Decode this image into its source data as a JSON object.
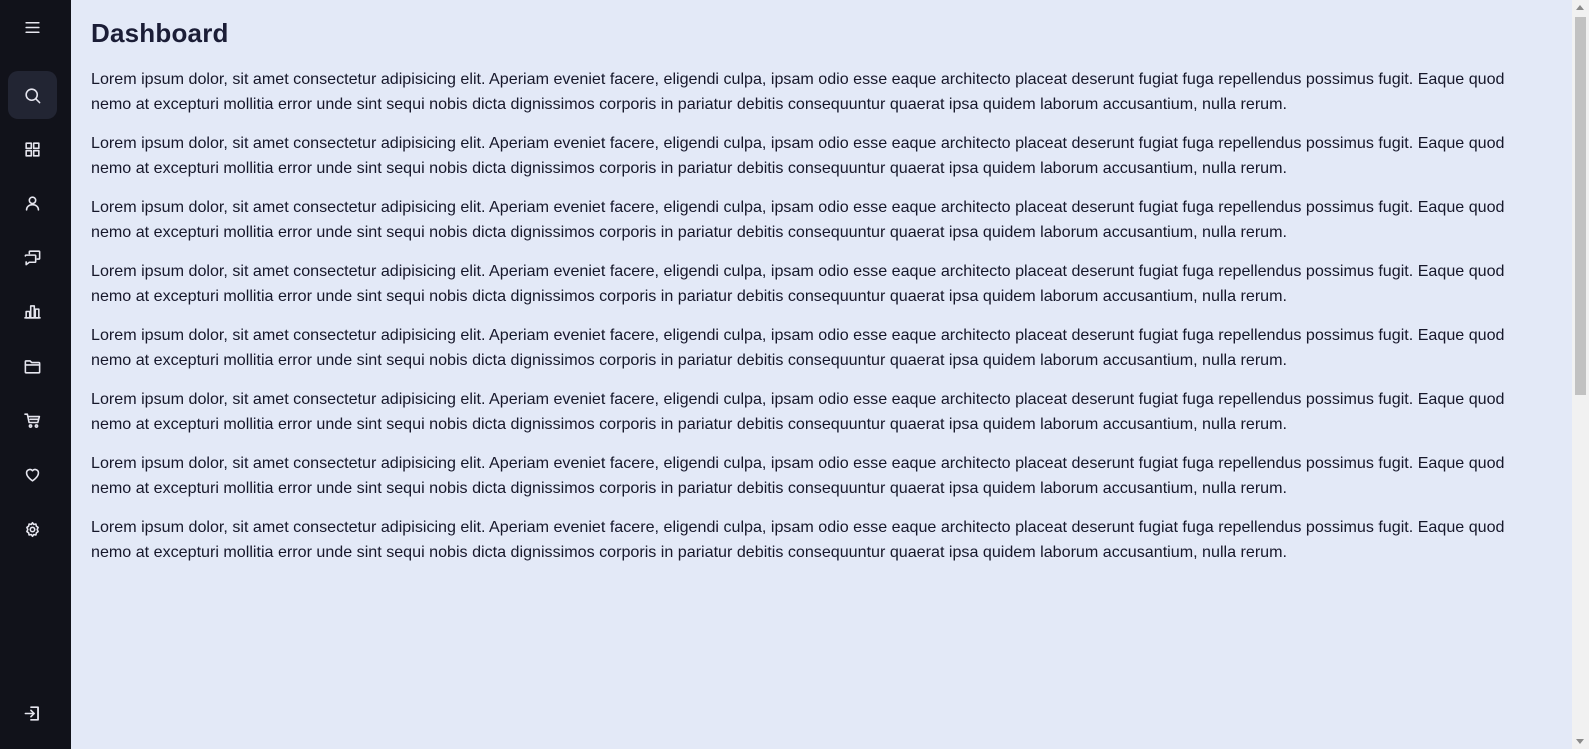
{
  "colors": {
    "sidebar_bg": "#11121a",
    "active_item_bg": "#222533",
    "main_bg": "#e3e9f7",
    "title_text": "#1b1d36",
    "body_text": "#16172a"
  },
  "sidebar": {
    "items": [
      {
        "icon": "menu-icon",
        "active": false
      },
      {
        "icon": "search-icon",
        "active": true
      },
      {
        "icon": "dashboard-grid-icon",
        "active": false
      },
      {
        "icon": "user-icon",
        "active": false
      },
      {
        "icon": "chat-icon",
        "active": false
      },
      {
        "icon": "bar-chart-icon",
        "active": false
      },
      {
        "icon": "folder-icon",
        "active": false
      },
      {
        "icon": "cart-icon",
        "active": false
      },
      {
        "icon": "heart-icon",
        "active": false
      },
      {
        "icon": "gear-icon",
        "active": false
      },
      {
        "icon": "logout-icon",
        "active": false
      }
    ]
  },
  "main": {
    "title": "Dashboard",
    "paragraphs": [
      "Lorem ipsum dolor, sit amet consectetur adipisicing elit. Aperiam eveniet facere, eligendi culpa, ipsam odio esse eaque architecto placeat deserunt fugiat fuga repellendus possimus fugit. Eaque quod nemo at excepturi mollitia error unde sint sequi nobis dicta dignissimos corporis in pariatur debitis consequuntur quaerat ipsa quidem laborum accusantium, nulla rerum.",
      "Lorem ipsum dolor, sit amet consectetur adipisicing elit. Aperiam eveniet facere, eligendi culpa, ipsam odio esse eaque architecto placeat deserunt fugiat fuga repellendus possimus fugit. Eaque quod nemo at excepturi mollitia error unde sint sequi nobis dicta dignissimos corporis in pariatur debitis consequuntur quaerat ipsa quidem laborum accusantium, nulla rerum.",
      "Lorem ipsum dolor, sit amet consectetur adipisicing elit. Aperiam eveniet facere, eligendi culpa, ipsam odio esse eaque architecto placeat deserunt fugiat fuga repellendus possimus fugit. Eaque quod nemo at excepturi mollitia error unde sint sequi nobis dicta dignissimos corporis in pariatur debitis consequuntur quaerat ipsa quidem laborum accusantium, nulla rerum.",
      "Lorem ipsum dolor, sit amet consectetur adipisicing elit. Aperiam eveniet facere, eligendi culpa, ipsam odio esse eaque architecto placeat deserunt fugiat fuga repellendus possimus fugit. Eaque quod nemo at excepturi mollitia error unde sint sequi nobis dicta dignissimos corporis in pariatur debitis consequuntur quaerat ipsa quidem laborum accusantium, nulla rerum.",
      "Lorem ipsum dolor, sit amet consectetur adipisicing elit. Aperiam eveniet facere, eligendi culpa, ipsam odio esse eaque architecto placeat deserunt fugiat fuga repellendus possimus fugit. Eaque quod nemo at excepturi mollitia error unde sint sequi nobis dicta dignissimos corporis in pariatur debitis consequuntur quaerat ipsa quidem laborum accusantium, nulla rerum.",
      "Lorem ipsum dolor, sit amet consectetur adipisicing elit. Aperiam eveniet facere, eligendi culpa, ipsam odio esse eaque architecto placeat deserunt fugiat fuga repellendus possimus fugit. Eaque quod nemo at excepturi mollitia error unde sint sequi nobis dicta dignissimos corporis in pariatur debitis consequuntur quaerat ipsa quidem laborum accusantium, nulla rerum.",
      "Lorem ipsum dolor, sit amet consectetur adipisicing elit. Aperiam eveniet facere, eligendi culpa, ipsam odio esse eaque architecto placeat deserunt fugiat fuga repellendus possimus fugit. Eaque quod nemo at excepturi mollitia error unde sint sequi nobis dicta dignissimos corporis in pariatur debitis consequuntur quaerat ipsa quidem laborum accusantium, nulla rerum.",
      "Lorem ipsum dolor, sit amet consectetur adipisicing elit. Aperiam eveniet facere, eligendi culpa, ipsam odio esse eaque architecto placeat deserunt fugiat fuga repellendus possimus fugit. Eaque quod nemo at excepturi mollitia error unde sint sequi nobis dicta dignissimos corporis in pariatur debitis consequuntur quaerat ipsa quidem laborum accusantium, nulla rerum."
    ]
  }
}
